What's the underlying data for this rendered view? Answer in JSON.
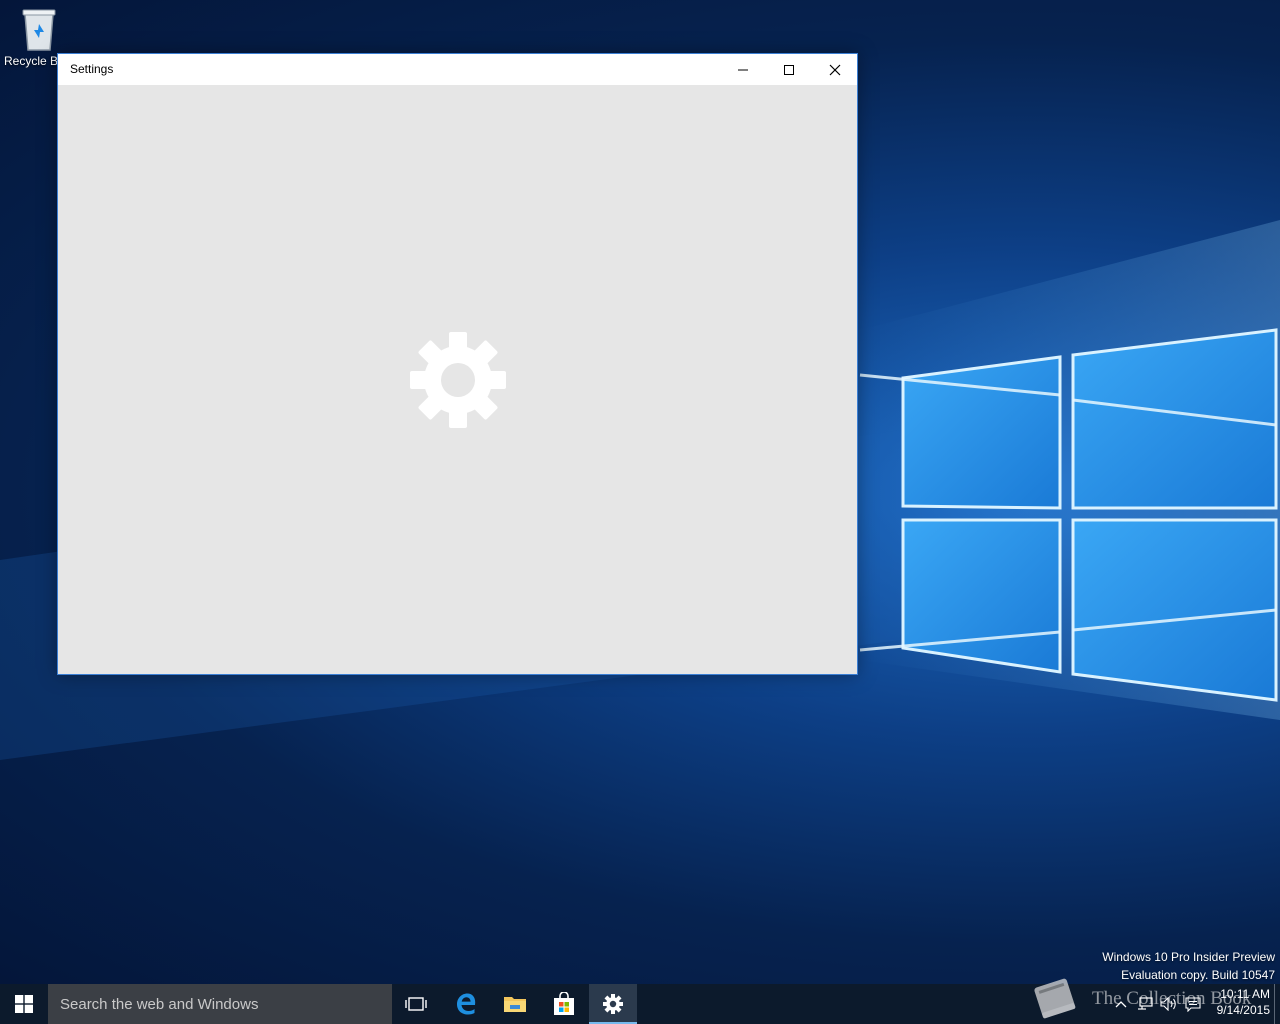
{
  "desktop": {
    "icons": [
      {
        "label": "Recycle Bin",
        "icon": "recycle-bin-icon"
      }
    ]
  },
  "window": {
    "title": "Settings",
    "controls": {
      "minimize_icon": "minimize-icon",
      "maximize_icon": "maximize-icon",
      "close_icon": "close-icon"
    },
    "splash_icon": "gear-icon"
  },
  "watermark": {
    "line1": "Windows 10 Pro Insider Preview",
    "line2": "Evaluation copy. Build 10547"
  },
  "taskbar": {
    "start_icon": "windows-logo-icon",
    "search_placeholder": "Search the web and Windows",
    "pinned": [
      {
        "name": "Task View",
        "icon": "task-view-icon"
      },
      {
        "name": "Microsoft Edge",
        "icon": "edge-icon"
      },
      {
        "name": "File Explorer",
        "icon": "folder-icon"
      },
      {
        "name": "Store",
        "icon": "store-icon"
      },
      {
        "name": "Settings",
        "icon": "gear-icon",
        "active": true
      }
    ],
    "tray": {
      "icons": [
        "chevron-up-icon",
        "network-icon",
        "volume-icon",
        "action-center-icon"
      ],
      "time": "10:11 AM",
      "date": "9/14/2015"
    },
    "brand_text": "The Collection Book"
  },
  "colors": {
    "accent": "#3b7fd4",
    "taskbar": "#0c1a2c",
    "search_box": "#3b3f45",
    "window_body": "#e6e6e6",
    "active_indicator": "#76b9ed"
  }
}
